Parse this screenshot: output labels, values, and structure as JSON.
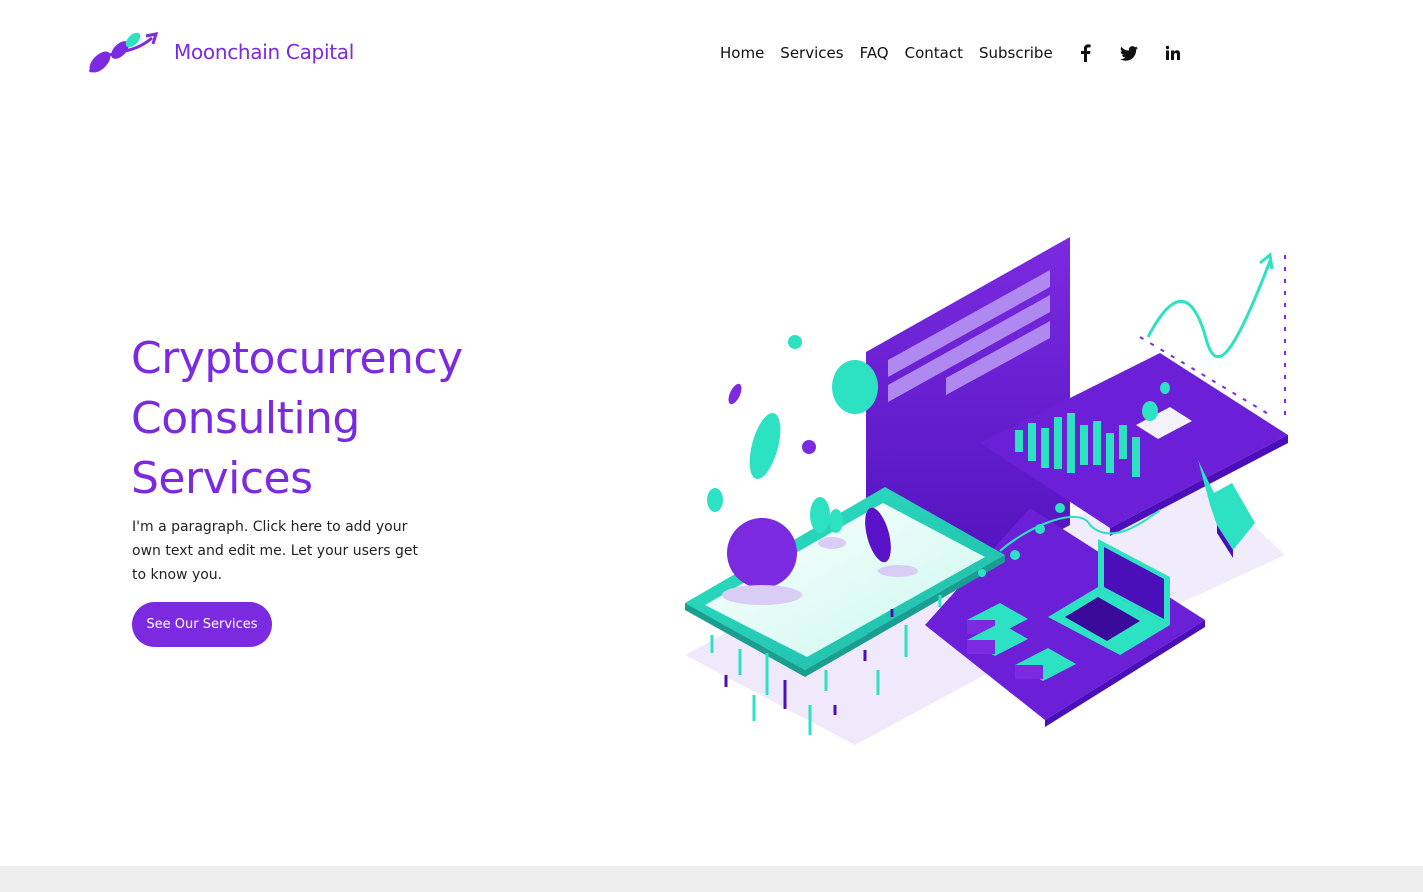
{
  "brand": {
    "name": "Moonchain Capital",
    "accent_color": "#7b2ae0",
    "secondary_color": "#2de2c3"
  },
  "nav": {
    "items": [
      {
        "label": "Home"
      },
      {
        "label": "Services"
      },
      {
        "label": "FAQ"
      },
      {
        "label": "Contact"
      },
      {
        "label": "Subscribe"
      }
    ]
  },
  "social": [
    {
      "icon": "facebook-icon",
      "glyph": "f"
    },
    {
      "icon": "twitter-icon",
      "glyph": "t"
    },
    {
      "icon": "linkedin-icon",
      "glyph": "in"
    }
  ],
  "hero": {
    "title_lines": [
      "Cryptocurrency",
      "Consulting",
      "Services"
    ],
    "paragraph": "I'm a paragraph. Click here to add your own text and edit me. Let your users get to know you.",
    "cta_label": "See Our Services"
  }
}
